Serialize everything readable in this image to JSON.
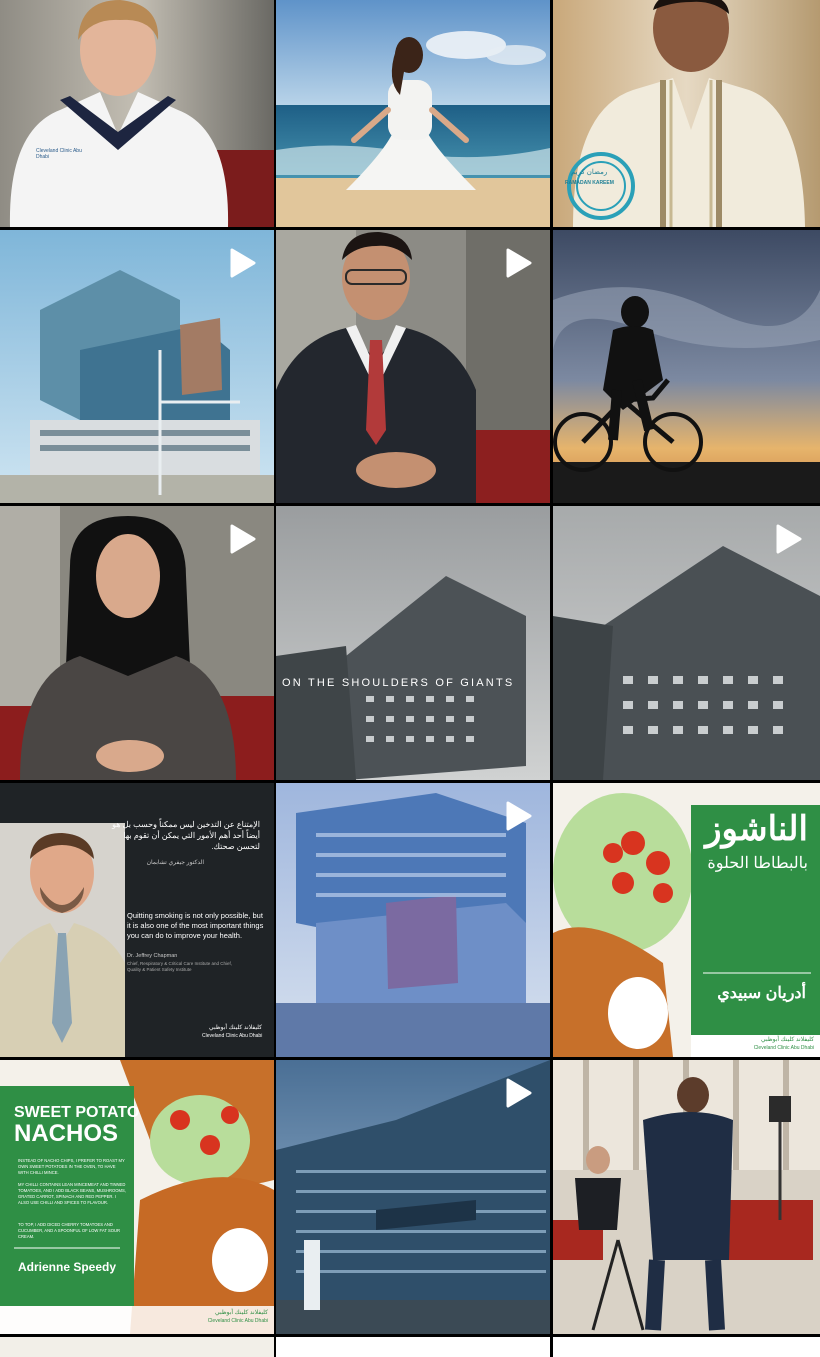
{
  "grid": {
    "tiles": [
      {
        "kind": "photo",
        "subject": "nurse-portrait",
        "video": false,
        "shirt_text": "Cleveland Clinic Abu Dhabi"
      },
      {
        "kind": "photo",
        "subject": "woman-meditating-beach",
        "video": false
      },
      {
        "kind": "photo",
        "subject": "man-ramadan-kareem",
        "video": false,
        "badge_ar": "رمضان كريم",
        "badge_en": "RAMADAN KAREEM"
      },
      {
        "kind": "photo",
        "subject": "hospital-building",
        "video": true
      },
      {
        "kind": "photo",
        "subject": "man-in-suit-interview",
        "video": true
      },
      {
        "kind": "photo",
        "subject": "cyclist-silhouette-sunset",
        "video": false
      },
      {
        "kind": "photo",
        "subject": "woman-in-hijab-interview",
        "video": true
      },
      {
        "kind": "photo",
        "subject": "building-shoulders-of-giants",
        "video": false,
        "overlay": "ON THE SHOULDERS OF GIANTS"
      },
      {
        "kind": "photo",
        "subject": "building-gray-sky",
        "video": true
      },
      {
        "kind": "quote",
        "subject": "quit-smoking-quote",
        "video": false,
        "quote_ar": "الإمتناع عن التدخين ليس ممكناً وحسب بل هو أيضاً أحد أهم الأمور التي يمكن أن تقوم بها لتحسن صحتك.",
        "quote_en": "Quitting smoking is not only possible, but it is also one of the most important things you can do to improve your health.",
        "name_ar": "الدكتور جيفري تشابمان",
        "name_en": "Dr. Jeffrey Chapman",
        "title_en": "Chief, Respiratory & Critical Care Institute and Chief, Quality & Patient Safety Institute",
        "logo_ar": "كليفلاند كلينك أبوظبي",
        "logo_en": "Cleveland Clinic Abu Dhabi"
      },
      {
        "kind": "photo",
        "subject": "hospital-building-blue",
        "video": true
      },
      {
        "kind": "recipe",
        "subject": "sweet-potato-nachos-ar",
        "video": false,
        "title": "الناشوز",
        "subtitle": "بالبطاطا الحلوة",
        "author": "أدريان سبيدي",
        "logo_ar": "كليفلاند كلينك أبوظبي",
        "logo_en": "Cleveland Clinic Abu Dhabi"
      },
      {
        "kind": "recipe",
        "subject": "sweet-potato-nachos-en",
        "video": false,
        "title_line1": "SWEET POTATO",
        "title_line2": "NACHOS",
        "body1": "INSTEAD OF NACHO CHIPS, I PREFER TO ROAST MY OWN SWEET POTATOES IN THE OVEN, TO HAVE WITH CHILLI MINCE.",
        "body2": "MY CHILLI CONTAINS LEAN MINCEMEAT AND TINNED TOMATOES, AND I ADD BLACK BEANS, MUSHROOMS, GRATED CARROT, SPINACH AND RED PEPPER. I ALSO USE CHILLI AND SPICES TO FLAVOUR.",
        "body3": "TO TOP, I ADD DICED CHERRY TOMATOES AND CUCUMBER, AND A SPOONFUL OF LOW FAT SOUR CREAM.",
        "author": "Adrienne Speedy",
        "logo_ar": "كليفلاند كلينك أبوظبي",
        "logo_en": "Cleveland Clinic Abu Dhabi"
      },
      {
        "kind": "photo",
        "subject": "hospital-dusk",
        "video": true
      },
      {
        "kind": "photo",
        "subject": "film-crew-interview-setup",
        "video": false
      }
    ]
  },
  "colors": {
    "green": "#2f8f45",
    "dark": "#1f2326"
  }
}
